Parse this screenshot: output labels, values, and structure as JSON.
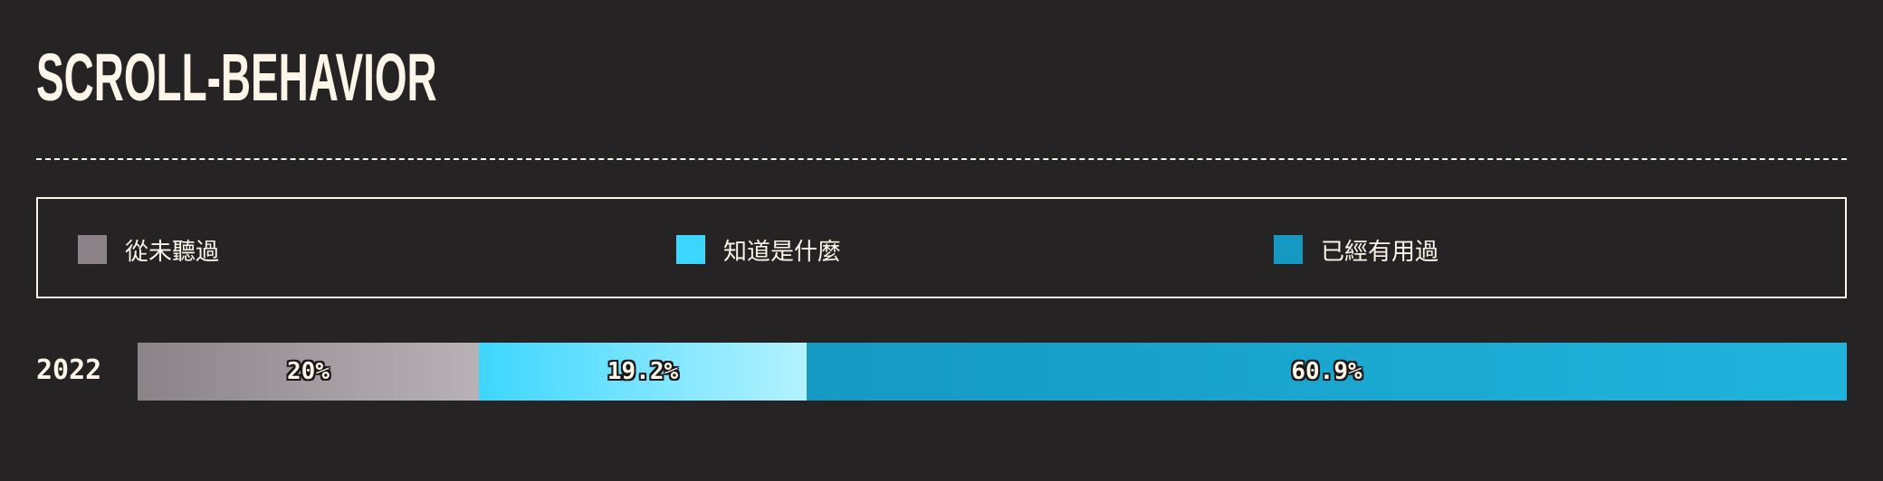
{
  "header": {
    "title": "SCROLL-BEHAVIOR"
  },
  "legend": {
    "items": [
      {
        "label": "從未聽過",
        "color": "#8b8388"
      },
      {
        "label": "知道是什麼",
        "color": "#3dd6ff"
      },
      {
        "label": "已經有用過",
        "color": "#1599c2"
      }
    ]
  },
  "chart_data": {
    "type": "bar",
    "orientation": "horizontal-stacked-percent",
    "categories": [
      "2022"
    ],
    "series": [
      {
        "name": "從未聽過",
        "values": [
          20
        ],
        "label": "20%",
        "color": "#8b8388",
        "gradient_end": "#b8b1b5"
      },
      {
        "name": "知道是什麼",
        "values": [
          19.2
        ],
        "label": "19.2%",
        "color": "#3dd6ff",
        "gradient_end": "#b3f2ff"
      },
      {
        "name": "已經有用過",
        "values": [
          60.9
        ],
        "label": "60.9%",
        "color": "#1599c2",
        "gradient_end": "#20b4dc"
      }
    ],
    "xlim": [
      0,
      100.1
    ],
    "grid": false,
    "legend_position": "top"
  }
}
